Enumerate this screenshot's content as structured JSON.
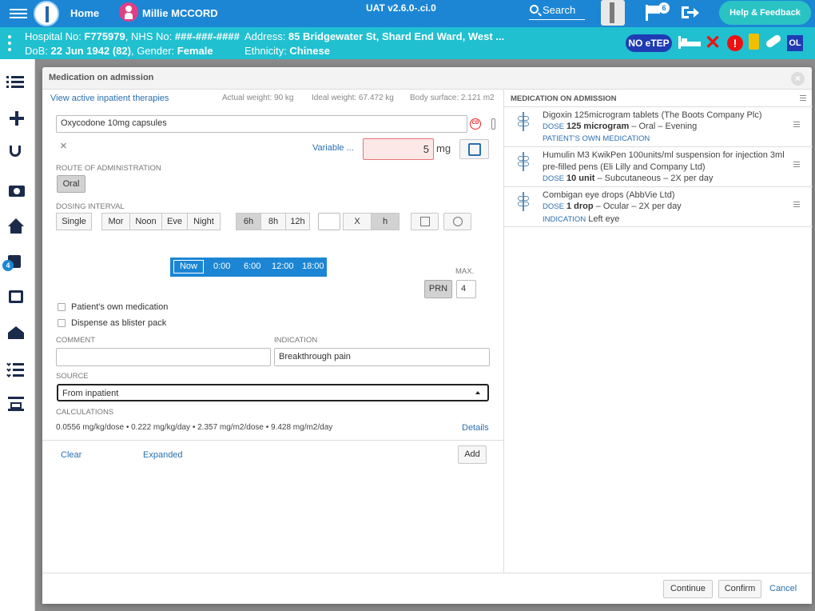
{
  "topbar": {
    "home_label": "Home",
    "user_name": "Millie MCCORD",
    "version": "UAT v2.6.0-.ci.0",
    "search_label": "Search",
    "notification_count": "6",
    "help_label": "Help & Feedback",
    "accent": "#1c86d4"
  },
  "banner": {
    "hospital_label": "Hospital No: ",
    "hospital_no": "F775979",
    "nhs_label": ", NHS No: ",
    "nhs_no": "###-###-####",
    "dob_label": "DoB: ",
    "dob": "22 Jun 1942 (82)",
    "gender_label": ", Gender: ",
    "gender": "Female",
    "address_label": "Address: ",
    "address": "85 Bridgewater St, Shard End Ward, West ...",
    "ethnicity_label": "Ethnicity: ",
    "ethnicity": "Chinese",
    "noetep_label": "NO eTEP",
    "ol_label": "OL",
    "color": "#20c0d0"
  },
  "sidebar": {
    "badge_count": "4",
    "items": [
      "list-icon",
      "plus-icon",
      "stethoscope-icon",
      "camera-icon",
      "house-icon",
      "edit-icon",
      "inbox-icon",
      "runner-icon",
      "checklist-icon",
      "sign-icon"
    ]
  },
  "modal": {
    "title": "Medication on admission",
    "close_symbol": "×"
  },
  "left": {
    "view_active_link": "View active inpatient therapies",
    "actual_weight": "Actual weight: 90 kg",
    "ideal_weight": "Ideal weight: 67.472 kg",
    "body_surface": "Body surface: 2.121 m2",
    "drug_value": "Oxycodone 10mg capsules",
    "cd_label": "CD",
    "clear_symbol": "×",
    "variable_link": "Variable ...",
    "dose_value": "5",
    "dose_unit": "mg",
    "route_label": "ROUTE OF ADMINISTRATION",
    "route_oral": "Oral",
    "dosing_label": "DOSING INTERVAL",
    "single": "Single",
    "mor": "Mor",
    "noon": "Noon",
    "eve": "Eve",
    "night": "Night",
    "h6": "6h",
    "h8": "8h",
    "h12": "12h",
    "x": "X",
    "h": "h",
    "time_now": "Now",
    "times": [
      "0:00",
      "6:00",
      "12:00",
      "18:00"
    ],
    "max_label": "MAX.",
    "prn": "PRN",
    "max_value": "4",
    "own_med_label": "Patient's own medication",
    "blister_label": "Dispense as blister pack",
    "comment_label": "COMMENT",
    "comment_value": "",
    "indication_label": "INDICATION",
    "indication_value": "Breakthrough pain",
    "source_label": "SOURCE",
    "source_value": "From inpatient",
    "calc_label": "CALCULATIONS",
    "calc_value": "0.0556 mg/kg/dose • 0.222 mg/kg/day • 2.357 mg/m2/dose • 9.428 mg/m2/day",
    "details_link": "Details",
    "clear_link": "Clear",
    "expanded_link": "Expanded",
    "add_button": "Add"
  },
  "right": {
    "title": "MEDICATION ON ADMISSION",
    "meds": [
      {
        "name": "Digoxin 125microgram tablets (The Boots Company Plc)",
        "dose_key": "DOSE",
        "dose": "125 microgram",
        "rest": " – Oral – Evening",
        "tag": "PATIENT'S OWN MEDICATION"
      },
      {
        "name": "Humulin M3 KwikPen 100units/ml suspension for injection 3ml pre-filled pens (Eli Lilly and Company Ltd)",
        "dose_key": "DOSE",
        "dose": "10 unit",
        "rest": " – Subcutaneous – 2X per day"
      },
      {
        "name": "Combigan eye drops (AbbVie Ltd)",
        "dose_key": "DOSE",
        "dose": "1 drop",
        "rest": " – Ocular – 2X per day",
        "ind_key": "INDICATION",
        "ind_value": "Left eye"
      }
    ]
  },
  "footer": {
    "continue": "Continue",
    "confirm": "Confirm",
    "cancel": "Cancel"
  }
}
